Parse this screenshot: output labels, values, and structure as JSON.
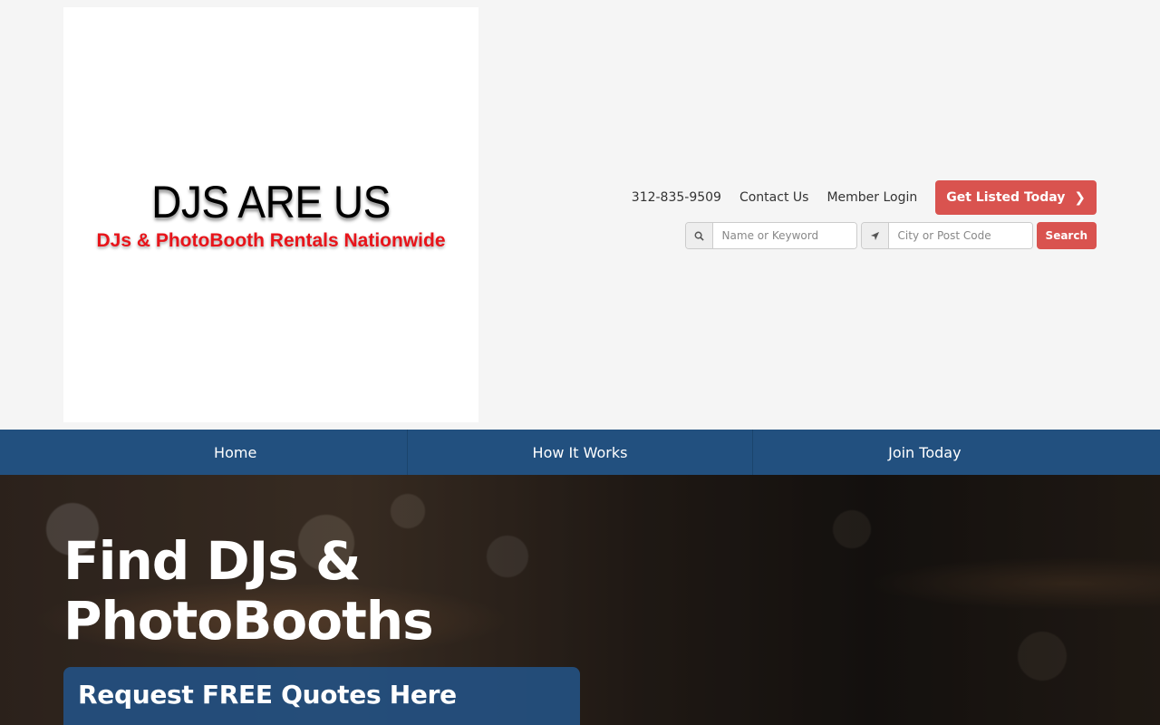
{
  "logo": {
    "main": "DJS ARE US",
    "sub": "DJs & PhotoBooth Rentals Nationwide"
  },
  "top_links": {
    "phone": "312-835-9509",
    "contact": "Contact Us",
    "login": "Member Login",
    "get_listed": "Get Listed Today"
  },
  "search": {
    "keyword_placeholder": "Name or Keyword",
    "location_placeholder": "City or Post Code",
    "button": "Search"
  },
  "nav": {
    "items": [
      {
        "label": "Home"
      },
      {
        "label": "How It Works"
      },
      {
        "label": "Join Today"
      }
    ]
  },
  "hero": {
    "title_line1": "Find DJs &",
    "title_line2": "PhotoBooths",
    "quote_title": "Request FREE Quotes Here"
  },
  "colors": {
    "accent": "#d9534f",
    "nav": "#22507f",
    "logo_sub": "#e8141a"
  }
}
